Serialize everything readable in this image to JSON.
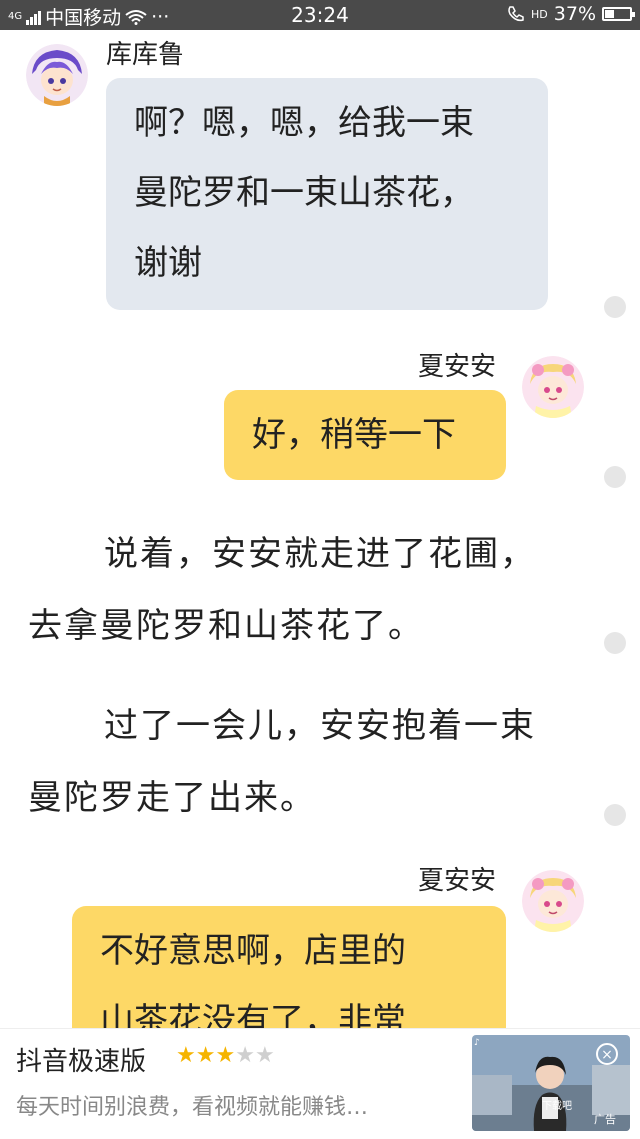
{
  "status": {
    "network_badge": "4G",
    "carrier": "中国移动",
    "more": "···",
    "time": "23:24",
    "hd": "HD",
    "battery": "37%"
  },
  "messages": [
    {
      "speaker": "库库鲁",
      "lines": [
        "啊？嗯，嗯，给我一束",
        "曼陀罗和一束山茶花，",
        "谢谢"
      ]
    },
    {
      "speaker": "夏安安",
      "lines": [
        "好，稍等一下"
      ]
    }
  ],
  "narration": [
    {
      "lines": [
        "说着，安安就走进了花圃，",
        "去拿曼陀罗和山茶花了。"
      ]
    },
    {
      "lines": [
        "过了一会儿，安安抱着一束",
        "曼陀罗走了出来。"
      ]
    }
  ],
  "last_message": {
    "speaker": "夏安安",
    "lines": [
      "不好意思啊，店里的",
      "山茶花没有了，非常"
    ]
  },
  "ad": {
    "title": "抖音极速版",
    "rating": 3,
    "rating_max": 5,
    "description": "每天时间别浪费，看视频就能赚钱…",
    "thumb_caption": "下载吧",
    "tag": "广告",
    "close": "×"
  }
}
